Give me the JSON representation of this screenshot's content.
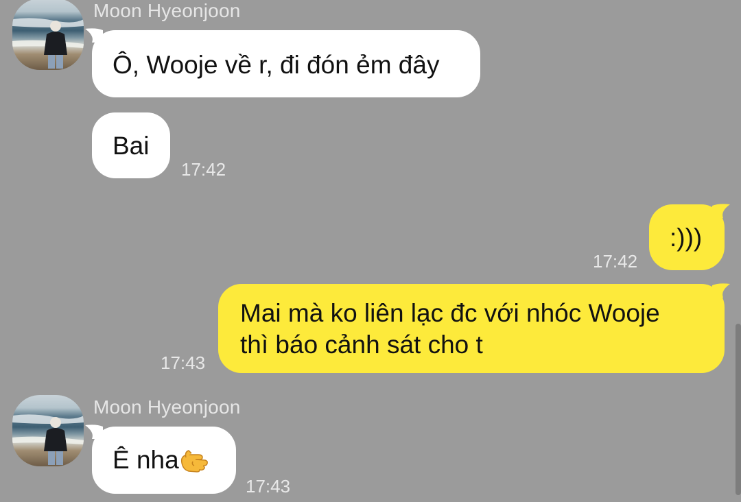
{
  "messages": [
    {
      "sender": "Moon Hyeonjoon",
      "text": "Ô, Wooje về r, đi đón ẻm đây"
    },
    {
      "text": "Bai",
      "time": "17:42"
    },
    {
      "text": ":)))",
      "time": "17:42"
    },
    {
      "line1": "Mai mà ko liên lạc đc với nhóc Wooje",
      "line2": "thì báo cảnh sát cho t",
      "time": "17:43"
    },
    {
      "sender": "Moon Hyeonjoon",
      "text": "Ê nha",
      "emoji": "pointing-finger-icon",
      "time": "17:43"
    }
  ],
  "colors": {
    "background": "#9b9b9b",
    "incoming_bubble": "#ffffff",
    "outgoing_bubble": "#fdea3b"
  }
}
